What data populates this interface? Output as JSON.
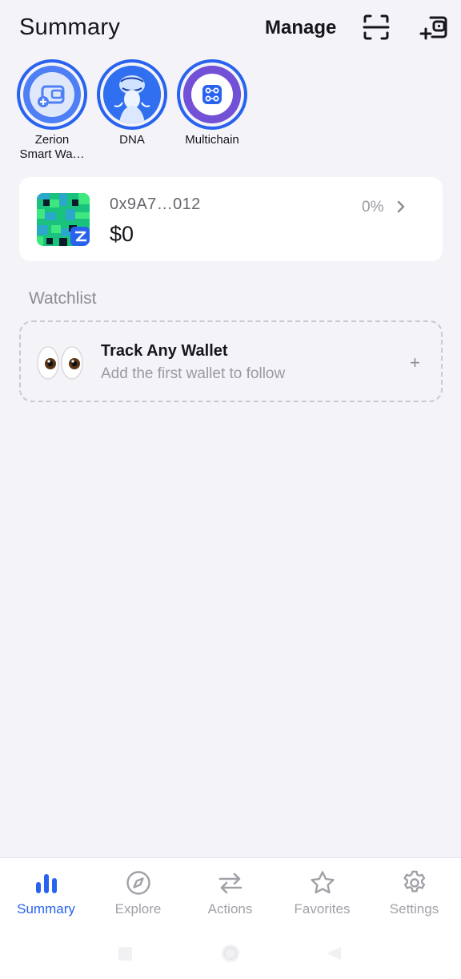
{
  "header": {
    "title": "Summary",
    "manage_label": "Manage",
    "scan_icon": "scan-qr-icon",
    "add_wallet_icon": "add-wallet-icon"
  },
  "stories": [
    {
      "label": "Zerion\nSmart Wa…",
      "icon": "smart-wallet-icon"
    },
    {
      "label": "DNA",
      "icon": "dna-figure-image"
    },
    {
      "label": "Multichain",
      "icon": "multichain-icon"
    }
  ],
  "wallet": {
    "address": "0x9A7…012",
    "balance": "$0",
    "change": "0%"
  },
  "watchlist": {
    "section_title": "Watchlist",
    "title": "Track Any Wallet",
    "subtitle": "Add the first wallet to follow",
    "plus": "+"
  },
  "tabs": [
    {
      "label": "Summary",
      "icon": "bar-chart-icon",
      "active": true
    },
    {
      "label": "Explore",
      "icon": "compass-icon",
      "active": false
    },
    {
      "label": "Actions",
      "icon": "swap-arrows-icon",
      "active": false
    },
    {
      "label": "Favorites",
      "icon": "star-icon",
      "active": false
    },
    {
      "label": "Settings",
      "icon": "gear-icon",
      "active": false
    }
  ],
  "colors": {
    "accent": "#2962ef",
    "background": "#f3f3f8",
    "card": "#ffffff",
    "muted": "#9a9ba1"
  }
}
